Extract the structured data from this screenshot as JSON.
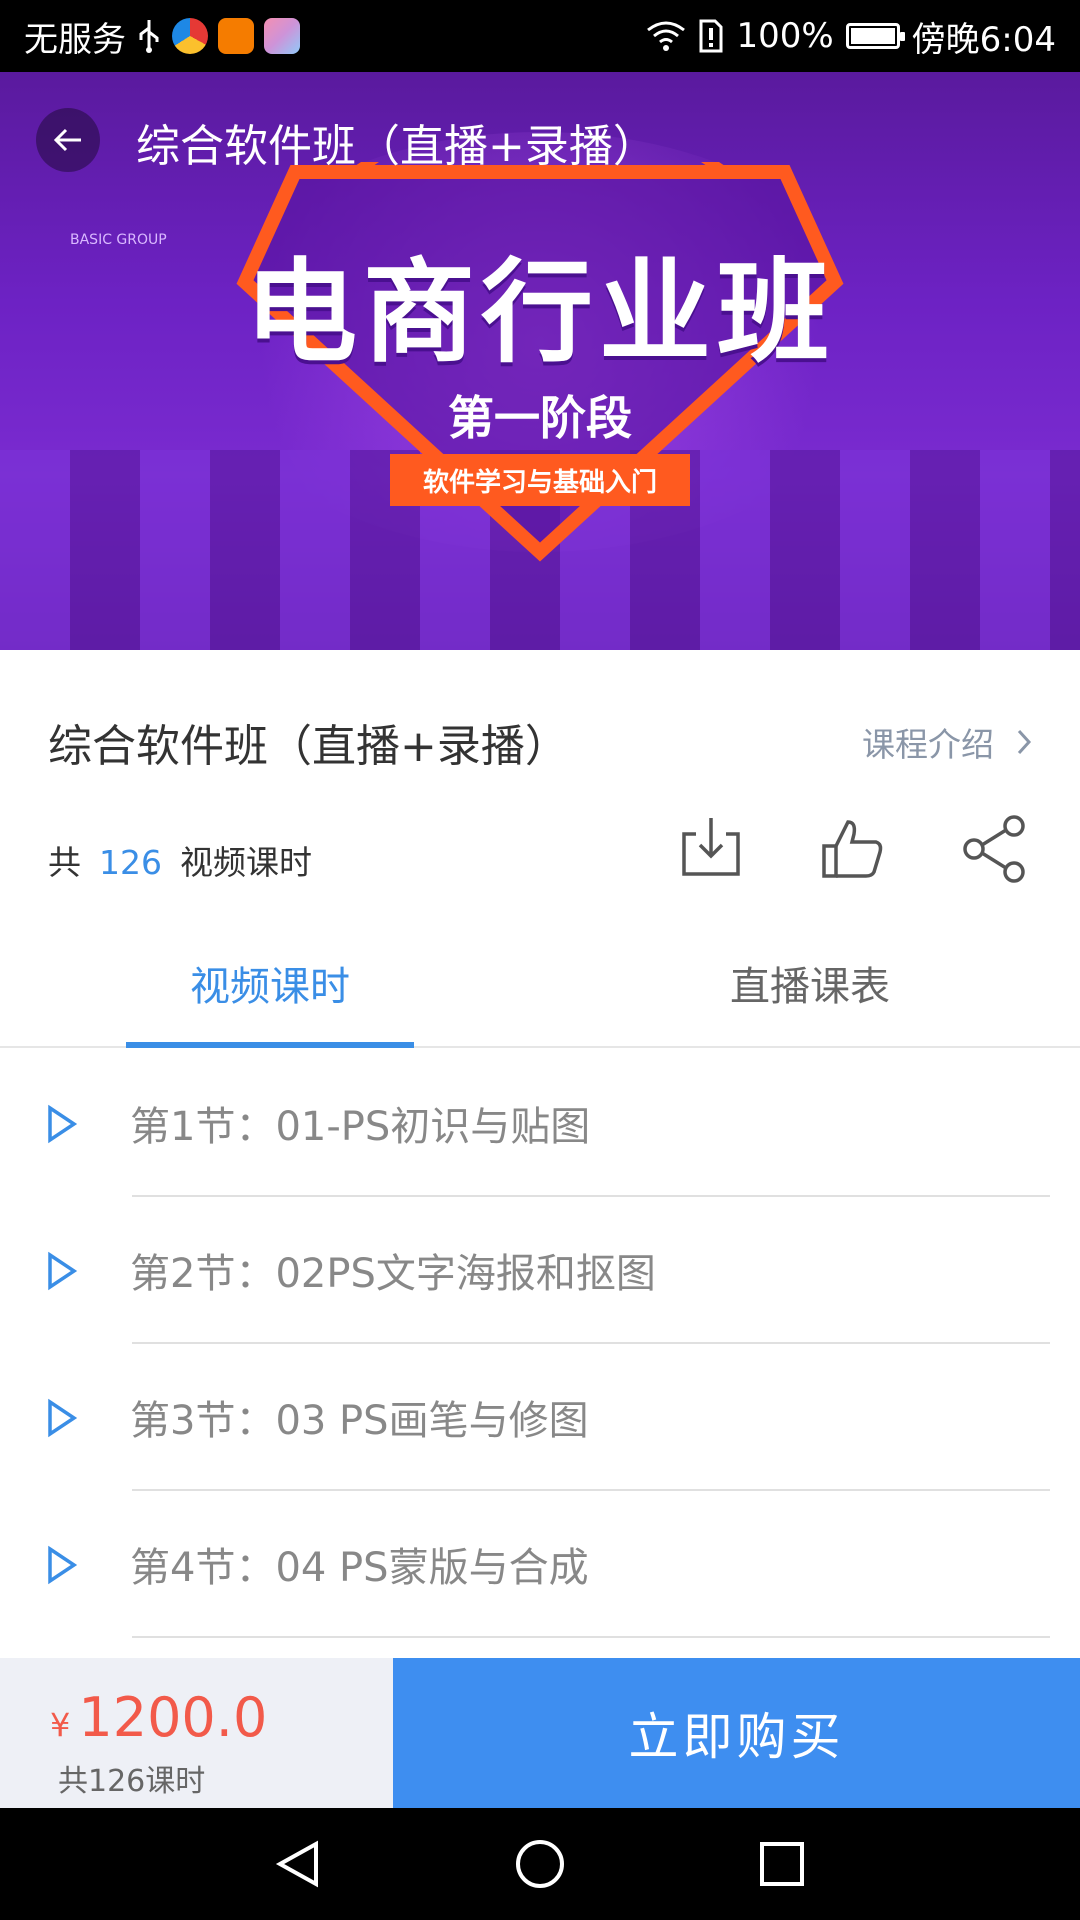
{
  "status_bar": {
    "carrier": "无服务",
    "battery_percent": "100%",
    "battery_level": 1.0,
    "time": "傍晚6:04",
    "app_icons": [
      "usb-icon",
      "browser-app-icon",
      "uc-browser-app-icon",
      "photos-app-icon"
    ]
  },
  "banner": {
    "title": "电商行业班",
    "stage": "第一阶段",
    "ribbon": "软件学习与基础入门",
    "corner_text": "BASIC GROUP"
  },
  "header": {
    "title": "综合软件班（直播+录播）"
  },
  "course": {
    "title": "综合软件班（直播+录播）",
    "intro_link": "课程介绍",
    "count_prefix": "共",
    "count_value": "126",
    "count_suffix": "视频课时",
    "actions": [
      "download-icon",
      "thumbs-up-icon",
      "share-icon"
    ]
  },
  "tabs": [
    {
      "label": "视频课时",
      "active": true
    },
    {
      "label": "直播课表",
      "active": false
    }
  ],
  "lessons": [
    {
      "label": "第1节：01-PS初识与贴图"
    },
    {
      "label": "第2节：02PS文字海报和抠图"
    },
    {
      "label": "第3节：03 PS画笔与修图"
    },
    {
      "label": "第4节：04 PS蒙版与合成"
    }
  ],
  "purchase": {
    "currency": "¥",
    "price": "1200.0",
    "lessons_note": "共126课时",
    "buy_label": "立即购买"
  },
  "colors": {
    "accent": "#3a8ee6",
    "buy_button": "#3e8ef0",
    "price": "#f25a4a",
    "banner_purple": "#6d22c4"
  }
}
